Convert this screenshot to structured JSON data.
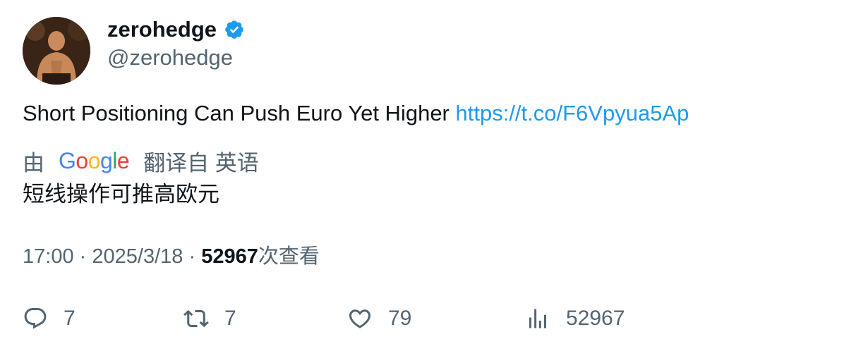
{
  "author": {
    "display_name": "zerohedge",
    "handle": "@zerohedge",
    "verified_icon": "verified-badge-icon",
    "verified_color": "#1d9bf0",
    "avatar": "profile-avatar"
  },
  "tweet": {
    "text": "Short Positioning Can Push Euro Yet Higher ",
    "link": "https://t.co/F6Vpyua5Ap",
    "link_color": "#1d9bf0"
  },
  "translation": {
    "prefix": "由",
    "provider": "Google",
    "suffix": "翻译自 英语",
    "text": "短线操作可推高欧元"
  },
  "meta": {
    "time": "17:00",
    "separator": "·",
    "date": "2025/3/18",
    "views_count": "52967",
    "views_label": "次查看"
  },
  "actions": {
    "replies": "7",
    "retweets": "7",
    "likes": "79",
    "views": "52967"
  }
}
